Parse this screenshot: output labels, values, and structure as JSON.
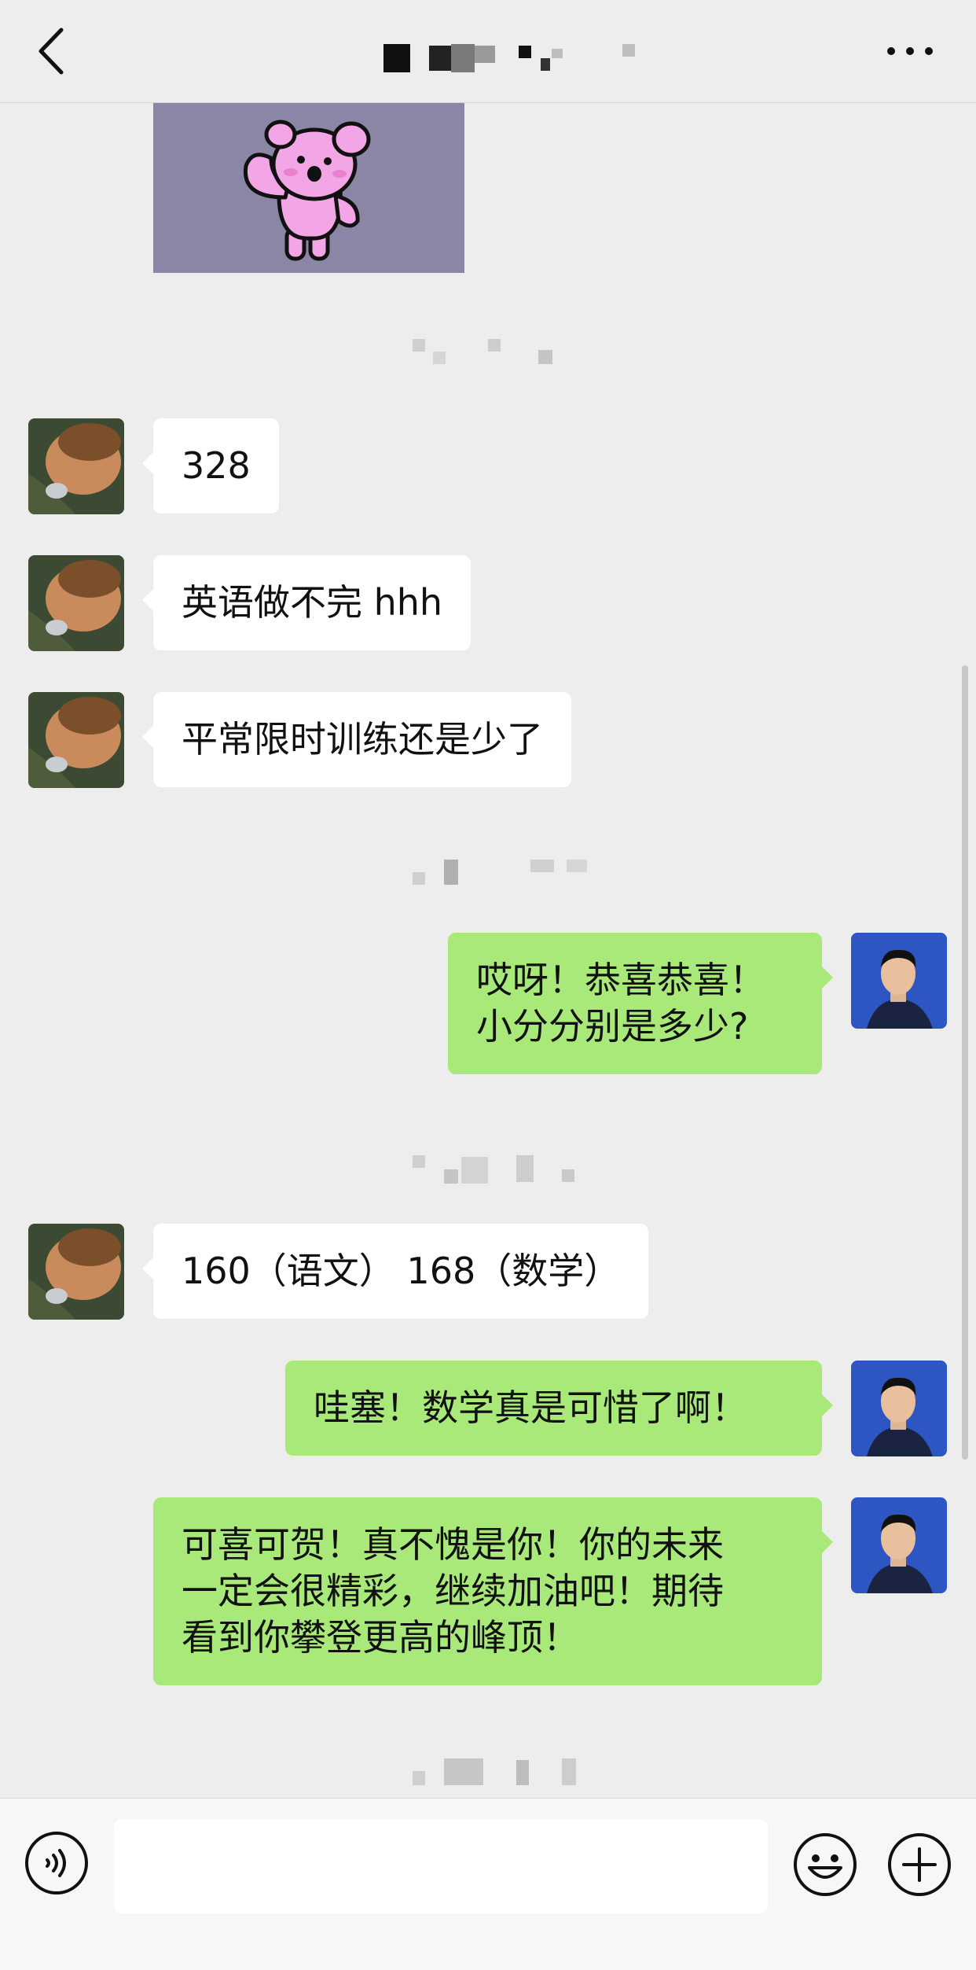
{
  "header": {
    "title": "",
    "back_icon": "chevron-left-icon",
    "more_icon": "more-horizontal-icon"
  },
  "messages": [
    {
      "side": "in",
      "text": "328"
    },
    {
      "side": "in",
      "text": "英语做不完 hhh"
    },
    {
      "side": "in",
      "text": "平常限时训练还是少了"
    },
    {
      "side": "out",
      "text": "哎呀！恭喜恭喜！\n小分分别是多少?"
    },
    {
      "side": "in",
      "text": "160（语文） 168（数学）"
    },
    {
      "side": "out",
      "text": "哇塞！数学真是可惜了啊！"
    },
    {
      "side": "out",
      "text": "可喜可贺！真不愧是你！你的未来\n一定会很精彩，继续加油吧！期待\n看到你攀登更高的峰顶！"
    }
  ],
  "input": {
    "value": "",
    "placeholder": ""
  },
  "bottom_icons": {
    "voice": "voice-icon",
    "emoji": "emoji-icon",
    "plus": "plus-icon"
  },
  "colors": {
    "background": "#ededed",
    "incoming_bubble": "#ffffff",
    "outgoing_bubble": "#a9e97a",
    "sticker_background": "#8c86a6",
    "sticker_pink": "#f3a6e6",
    "outgoing_avatar_bg": "#2d56c2"
  }
}
